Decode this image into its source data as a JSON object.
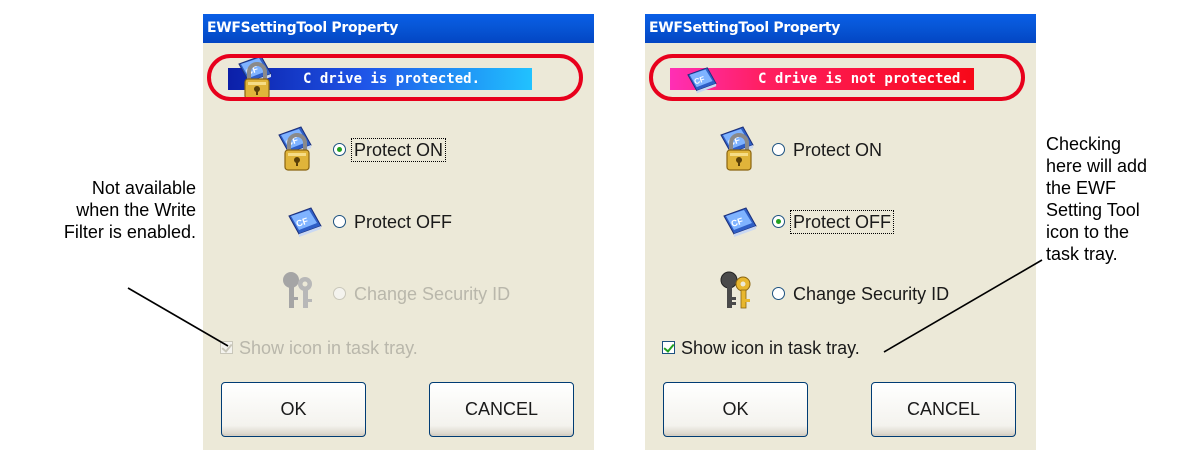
{
  "annotations": {
    "left_note": " Not available\nwhen the Write\nFilter is enabled.",
    "right_note": "Checking\nhere will add\nthe EWF\nSetting Tool\nicon to the\ntask tray."
  },
  "dialogs": [
    {
      "title": "EWFSettingTool Property",
      "status_text": "C drive is protected.",
      "status_icon": "lock-icon",
      "highlight_color": "#e8001c",
      "options": [
        {
          "label": "Protect ON",
          "icon": "cf-lock-icon",
          "selected": true,
          "disabled": false
        },
        {
          "label": "Protect OFF",
          "icon": "cf-card-icon",
          "selected": false,
          "disabled": false
        },
        {
          "label": "Change Security ID",
          "icon": "keys-icon",
          "selected": false,
          "disabled": true
        }
      ],
      "checkbox": {
        "label": "Show icon in task tray.",
        "checked": true,
        "disabled": true
      },
      "buttons": {
        "ok": "OK",
        "cancel": "CANCEL"
      }
    },
    {
      "title": "EWFSettingTool Property",
      "status_text": "C drive is not protected.",
      "status_icon": "cf-card-icon",
      "highlight_color": "#e8001c",
      "options": [
        {
          "label": "Protect ON",
          "icon": "cf-lock-icon",
          "selected": false,
          "disabled": false
        },
        {
          "label": "Protect OFF",
          "icon": "cf-card-icon",
          "selected": true,
          "disabled": false
        },
        {
          "label": "Change Security ID",
          "icon": "keys-icon",
          "selected": false,
          "disabled": false
        }
      ],
      "checkbox": {
        "label": "Show icon in task tray.",
        "checked": true,
        "disabled": false
      },
      "buttons": {
        "ok": "OK",
        "cancel": "CANCEL"
      }
    }
  ]
}
